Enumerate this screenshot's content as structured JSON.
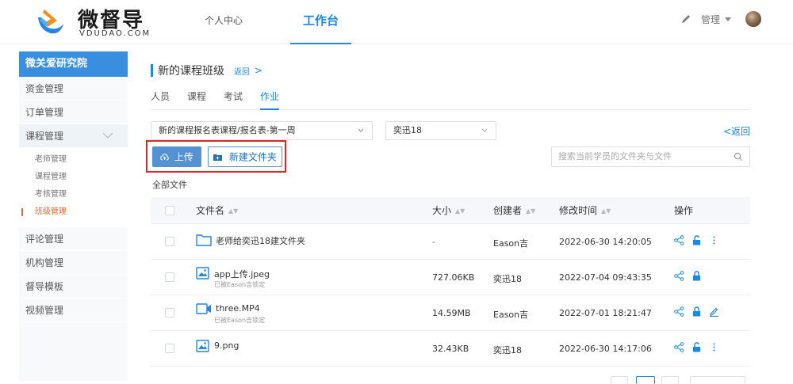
{
  "header": {
    "logo_cn": "微督导",
    "logo_en": "VDUDAO.COM",
    "nav": [
      {
        "label": "个人中心",
        "active": false
      },
      {
        "label": "工作台",
        "active": true
      }
    ],
    "user_menu_label": "管理",
    "icons": {
      "edit": "pencil-icon",
      "dropdown": "chevron-down-icon",
      "avatar": "avatar"
    }
  },
  "sidebar": {
    "org_name": "微关爱研究院",
    "items": [
      {
        "label": "资金管理"
      },
      {
        "label": "订单管理"
      },
      {
        "label": "课程管理",
        "expanded": true,
        "children": [
          {
            "label": "老师管理",
            "active": false
          },
          {
            "label": "课程管理",
            "active": false
          },
          {
            "label": "考核管理",
            "active": false
          },
          {
            "label": "班级管理",
            "active": true
          }
        ]
      },
      {
        "label": "评论管理"
      },
      {
        "label": "机构管理"
      },
      {
        "label": "督导模板"
      },
      {
        "label": "视频管理"
      }
    ]
  },
  "main": {
    "title": "新的课程班级",
    "back_link": "返回",
    "back_arrow": ">",
    "tabs": [
      {
        "label": "人员",
        "active": false
      },
      {
        "label": "课程",
        "active": false
      },
      {
        "label": "考试",
        "active": false
      },
      {
        "label": "作业",
        "active": true
      }
    ],
    "course_select": "新的课程报名表课程/报名表-第一周",
    "student_select": "奕迅18",
    "back_right": "<返回",
    "upload_button": "上传",
    "new_folder_button": "新建文件夹",
    "search_placeholder": "搜索当前学员的文件夹与文件",
    "section_label": "全部文件"
  },
  "table": {
    "columns": {
      "name": "文件名",
      "size": "大小",
      "creator": "创建者",
      "modified": "修改时间",
      "ops": "操作"
    },
    "rows": [
      {
        "type": "folder",
        "name": "老师给奕迅18建文件夹",
        "note": "",
        "size": "-",
        "creator": "Eason吉",
        "modified": "2022-06-30 14:20:05",
        "ops": [
          "share-icon",
          "unlock-icon",
          "more-icon"
        ]
      },
      {
        "type": "image",
        "name": "app上传.jpeg",
        "note": "已被Eason吉锁定",
        "size": "727.06KB",
        "creator": "奕迅18",
        "modified": "2022-07-04 09:43:35",
        "ops": [
          "share-icon",
          "lock-icon"
        ]
      },
      {
        "type": "video",
        "name": "three.MP4",
        "note": "已被Eason吉锁定",
        "size": "14.59MB",
        "creator": "Eason吉",
        "modified": "2022-07-01 18:21:47",
        "ops": [
          "share-icon",
          "lock-icon",
          "edit-icon"
        ]
      },
      {
        "type": "image",
        "name": "9.png",
        "note": "",
        "size": "32.43KB",
        "creator": "奕迅18",
        "modified": "2022-06-30 14:17:06",
        "ops": [
          "share-icon",
          "unlock-icon",
          "more-icon"
        ]
      }
    ]
  },
  "colors": {
    "accent": "#1e87e5",
    "sidebar_header": "#3a8ee0",
    "active_sub": "#e0682b",
    "highlight_box": "#e02323",
    "upload_button": "#5592d4"
  }
}
